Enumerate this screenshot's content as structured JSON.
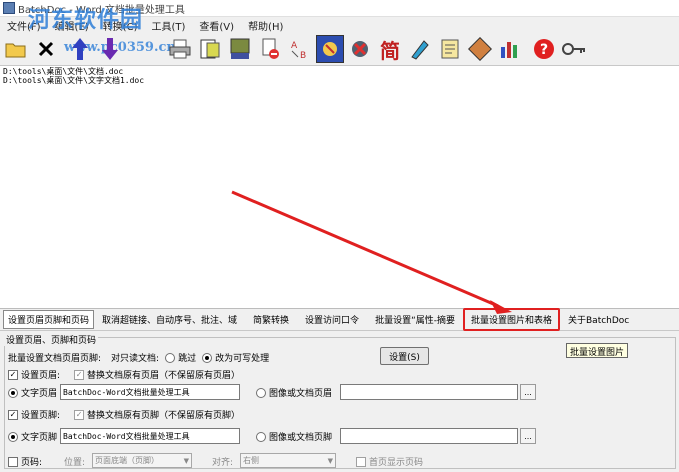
{
  "window": {
    "title": "BatchDoc - Word 文档批量处理工具"
  },
  "watermark": {
    "site": "河东软件园",
    "url": "www.pc0359.cn"
  },
  "menu": {
    "items": [
      "文件(F)",
      "编辑(E)",
      "转换(C)",
      "工具(T)",
      "查看(V)",
      "帮助(H)"
    ]
  },
  "toolbar": {
    "icons": [
      "open-folder-icon",
      "delete-icon",
      "move-up-icon",
      "move-down-icon",
      "print-icon",
      "replace-icon",
      "name-icon",
      "remove-doc-icon",
      "convert-text-icon",
      "stop-icon",
      "kill-process-icon",
      "simplified-icon",
      "edit-icon",
      "notes-icon",
      "document-tool-icon",
      "chart-icon",
      "help-icon",
      "key-icon"
    ],
    "simplified_char": "简"
  },
  "file_list": {
    "items": [
      "D:\\tools\\桌面\\文件\\文档.doc",
      "D:\\tools\\桌面\\文件\\文字文档1.doc"
    ]
  },
  "tabs": {
    "items": [
      "设置页眉页脚和页码",
      "取消超链接、自动序号、批注、域",
      "简繁转换",
      "设置访问口令",
      "批量设置“属性-摘要",
      "批量设置图片和表格",
      "关于BatchDoc"
    ],
    "tooltip": "批量设置图片"
  },
  "panel": {
    "group_title": "设置页眉、页脚和页码",
    "batch_label": "批量设置文档页眉页脚:",
    "readonly_label": "对只读文档:",
    "skip_label": "跳过",
    "writable_label": "改为可写处理",
    "set_button": "设置(S)",
    "header_check": "设置页眉:",
    "header_replace": "替换文档原有页眉（不保留原有页眉）",
    "text_header_label": "文字页眉",
    "text_header_value": "BatchDoc-Word文档批量处理工具",
    "image_header_label": "图像或文档页眉",
    "browse": "...",
    "footer_check": "设置页脚:",
    "footer_replace": "替换文档原有页脚（不保留原有页脚）",
    "text_footer_label": "文字页脚",
    "text_footer_value": "BatchDoc-Word文档批量处理工具",
    "image_footer_label": "图像或文档页脚",
    "page_number_check": "页码:",
    "position_label": "位置:",
    "position_value": "页面底端（页脚）",
    "align_label": "对齐:",
    "align_value": "右侧",
    "first_page_label": "首页显示页码"
  },
  "colors": {
    "highlight": "#e02020",
    "accent": "#2f7fd8"
  }
}
